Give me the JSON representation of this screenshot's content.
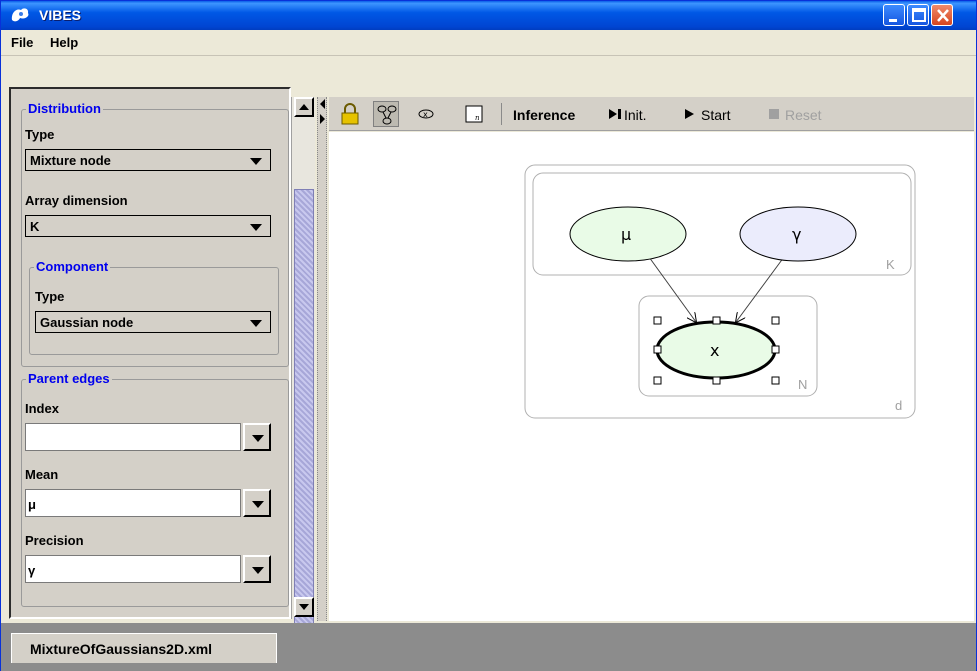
{
  "window": {
    "title": "VIBES"
  },
  "menu": {
    "file": "File",
    "help": "Help"
  },
  "distribution": {
    "legend": "Distribution",
    "type_label": "Type",
    "type_value": "Mixture node",
    "array_label": "Array dimension",
    "array_value": "K",
    "component": {
      "legend": "Component",
      "type_label": "Type",
      "type_value": "Gaussian node"
    }
  },
  "parent_edges": {
    "legend": "Parent edges",
    "index_label": "Index",
    "index_value": "",
    "mean_label": "Mean",
    "mean_value": "μ",
    "precision_label": "Precision",
    "precision_value": "γ"
  },
  "toolbar": {
    "inference": "Inference",
    "init": "Init.",
    "start": "Start",
    "reset": "Reset"
  },
  "graph": {
    "plates": {
      "outer": "d",
      "upper": "K",
      "lower": "N"
    },
    "nodes": {
      "mu": "μ",
      "gamma": "γ",
      "x": "x"
    }
  },
  "tabs": {
    "file_tab": "MixtureOfGaussians2D.xml"
  }
}
